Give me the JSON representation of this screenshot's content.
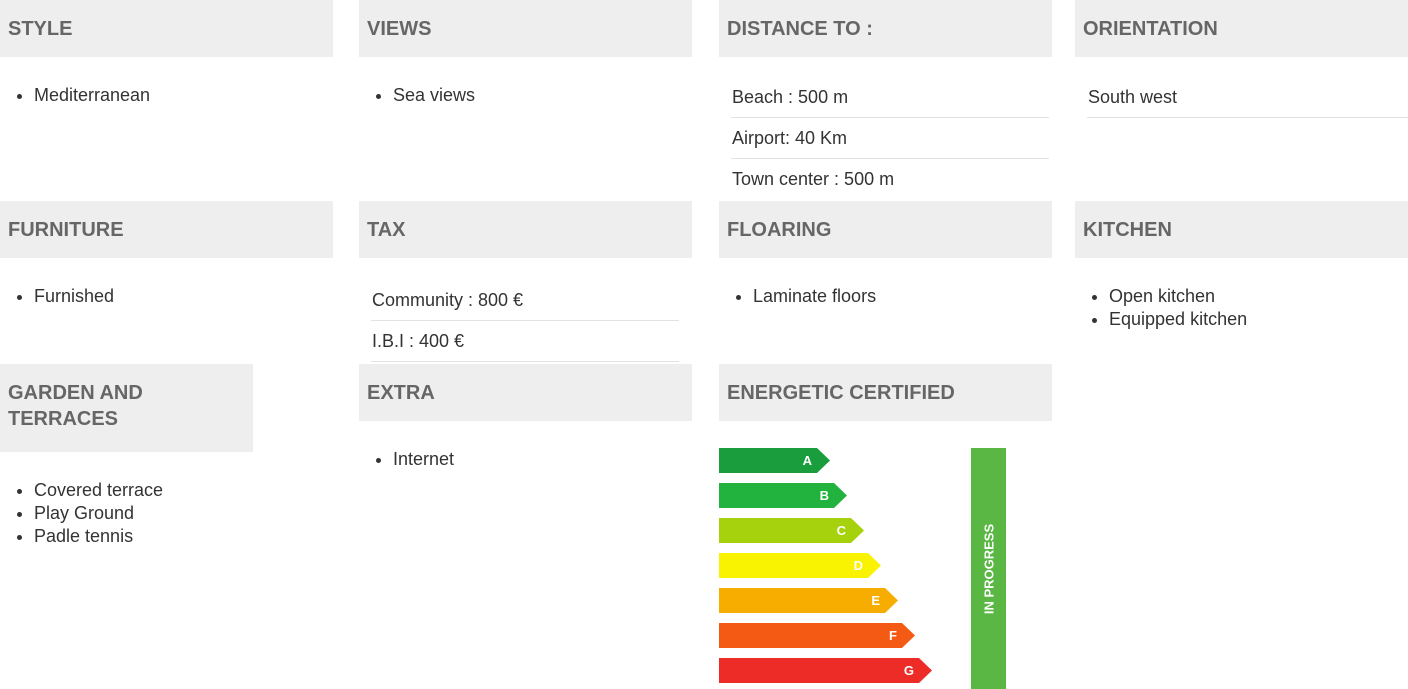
{
  "style": {
    "title": "STYLE",
    "items": [
      "Mediterranean"
    ]
  },
  "views": {
    "title": "VIEWS",
    "items": [
      "Sea views"
    ]
  },
  "distance": {
    "title": "DISTANCE TO :",
    "rows": [
      "Beach : 500 m",
      "Airport: 40 Km",
      "Town center : 500 m"
    ]
  },
  "orientation": {
    "title": "ORIENTATION",
    "rows": [
      "South west"
    ]
  },
  "furniture": {
    "title": "FURNITURE",
    "items": [
      "Furnished"
    ]
  },
  "tax": {
    "title": "TAX",
    "rows": [
      "Community : 800 €",
      "I.B.I : 400 €"
    ]
  },
  "flooring": {
    "title": "FLOARING",
    "items": [
      "Laminate floors"
    ]
  },
  "kitchen": {
    "title": "KITCHEN",
    "items": [
      "Open kitchen",
      "Equipped kitchen"
    ]
  },
  "garden": {
    "title": "GARDEN AND TERRACES",
    "items": [
      "Covered terrace",
      "Play Ground",
      "Padle tennis"
    ]
  },
  "extra": {
    "title": "EXTRA",
    "items": [
      "Internet"
    ]
  },
  "energy": {
    "title": "ENERGETIC CERTIFIED",
    "grades": [
      {
        "letter": "A",
        "color": "#1a9e3d"
      },
      {
        "letter": "B",
        "color": "#22b33f"
      },
      {
        "letter": "C",
        "color": "#a6d20d"
      },
      {
        "letter": "D",
        "color": "#f9f200"
      },
      {
        "letter": "E",
        "color": "#f7ad00"
      },
      {
        "letter": "F",
        "color": "#f55a15"
      },
      {
        "letter": "G",
        "color": "#ee2c27"
      }
    ],
    "status_label": "IN PROGRESS",
    "status_color": "#5ab744"
  }
}
